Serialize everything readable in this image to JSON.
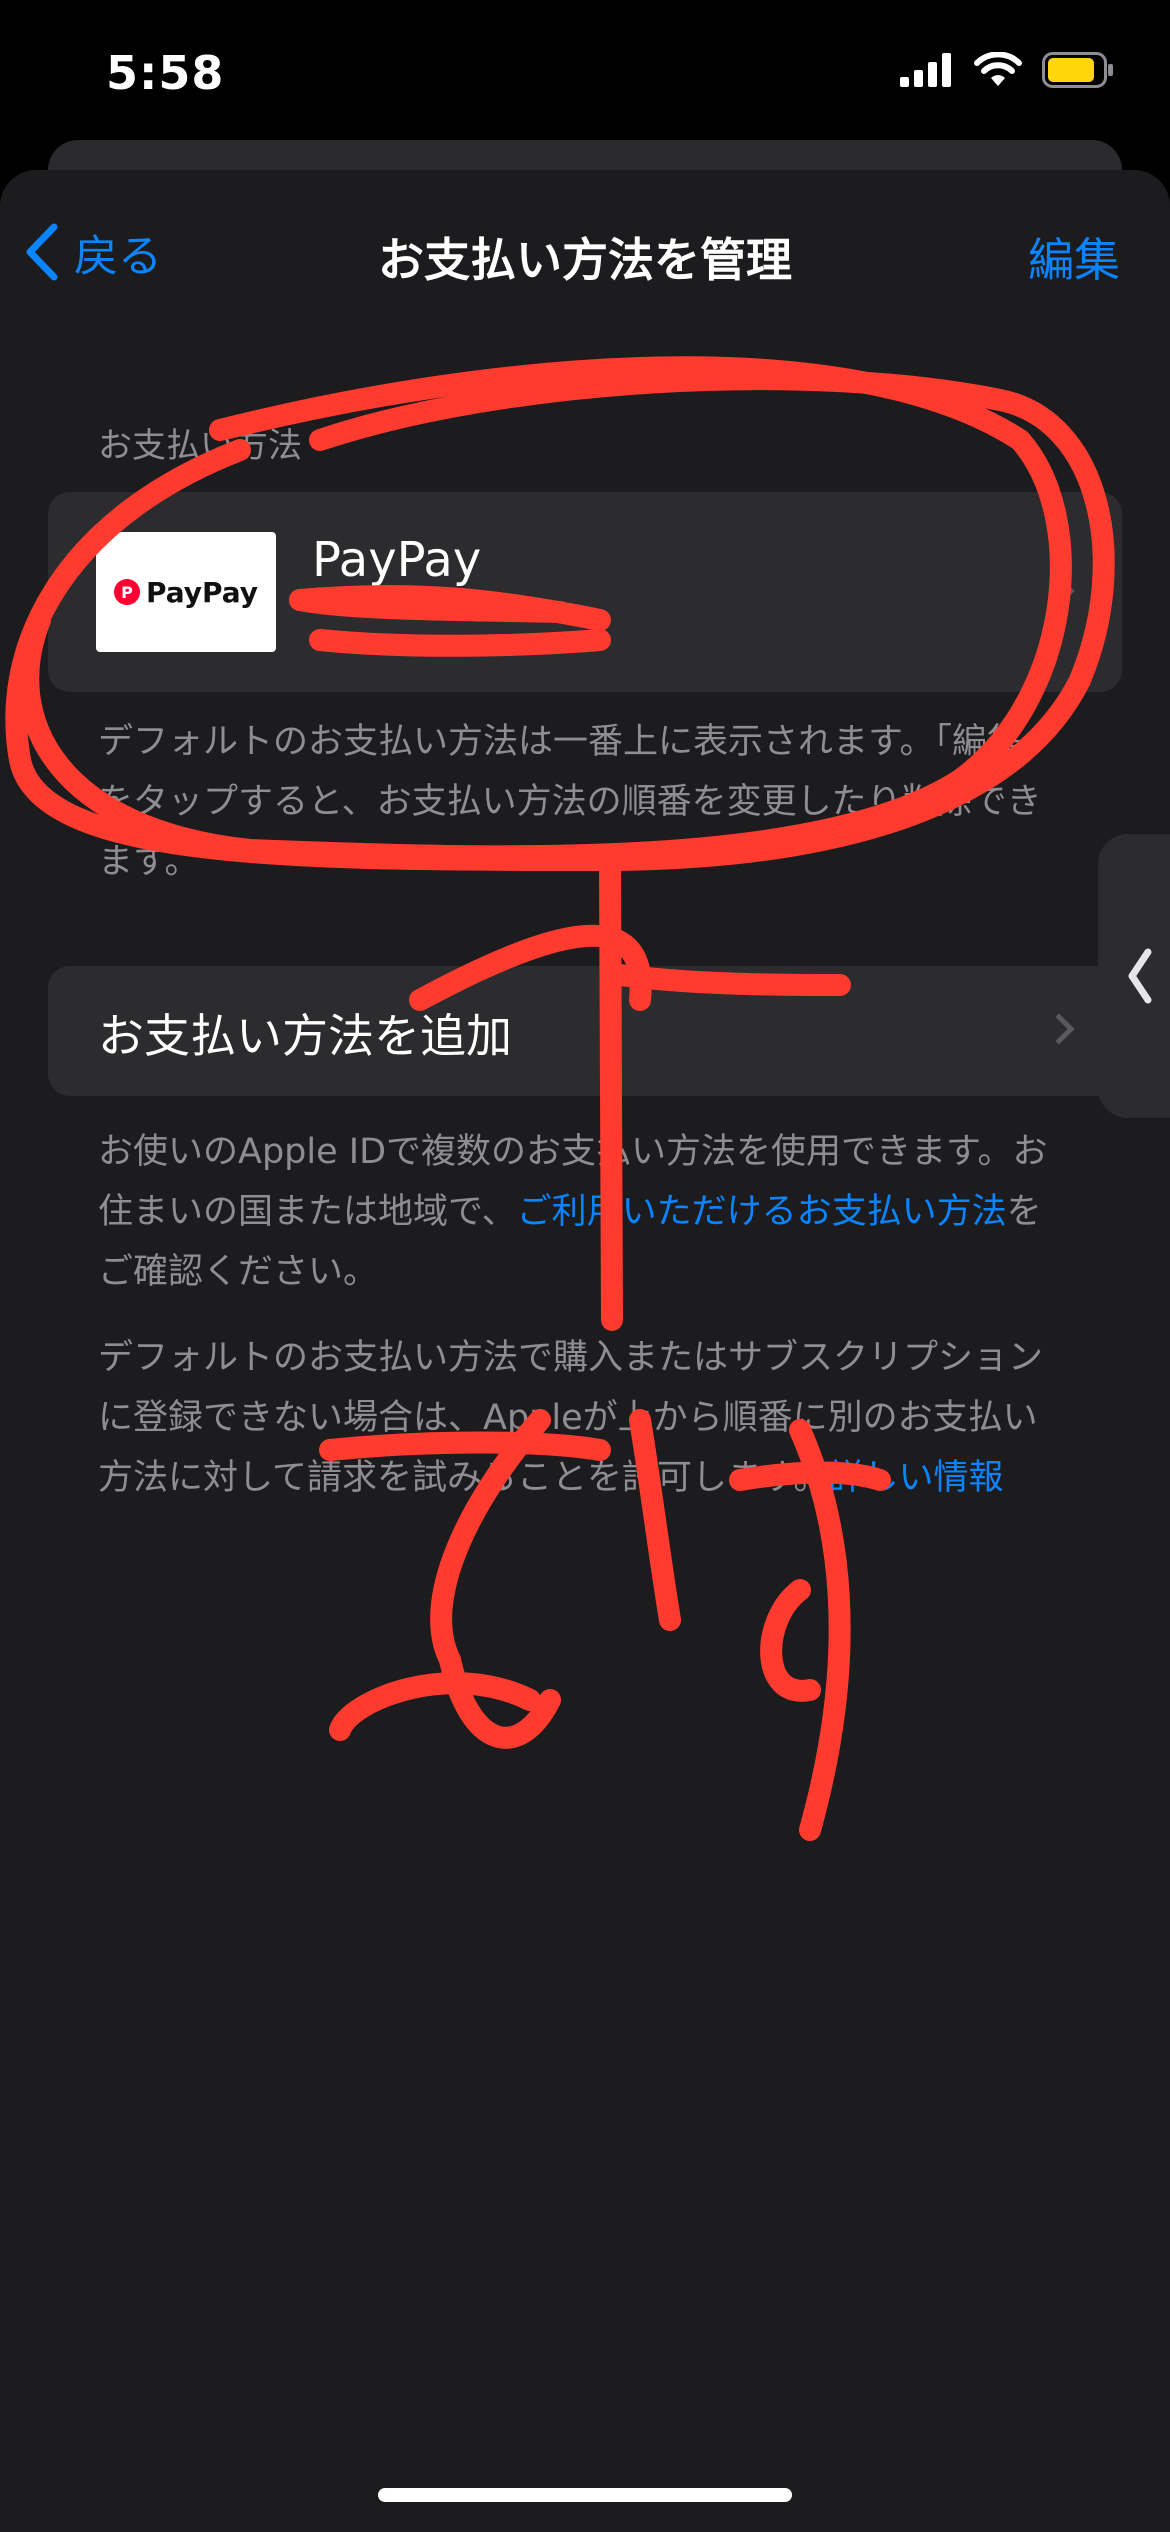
{
  "status_bar": {
    "time": "5:58"
  },
  "nav": {
    "back_label": "戻る",
    "title": "お支払い方法を管理",
    "edit_label": "編集"
  },
  "payment_section": {
    "header": "お支払い方法",
    "methods": [
      {
        "name": "PayPay",
        "logo_text": "PayPay"
      }
    ],
    "footnote": "デフォルトのお支払い方法は一番上に表示されます。「編集」をタップすると、お支払い方法の順番を変更したり削除できます。"
  },
  "add_payment": {
    "label": "お支払い方法を追加",
    "footnote_prefix": "お使いのApple IDで複数のお支払い方法を使用できます。お住まいの国または地域で、",
    "footnote_link": "ご利用いただけるお支払い方法",
    "footnote_suffix": "をご確認ください。"
  },
  "info": {
    "text": "デフォルトのお支払い方法で購入またはサブスクリプションに登録できない場合は、Appleが上から順番に別のお支払い方法に対して請求を試みることを許可します。",
    "link": "詳しい情報"
  },
  "colors": {
    "accent": "#0a84ff",
    "background": "#1c1c1e",
    "card": "#2c2c2e",
    "secondary_text": "#8d8d93",
    "annotation": "#ff3b30",
    "battery": "#ffd60a"
  },
  "icons": [
    "cellular-signal-icon",
    "wifi-icon",
    "battery-icon",
    "chevron-left-icon",
    "chevron-right-icon",
    "paypay-logo"
  ]
}
